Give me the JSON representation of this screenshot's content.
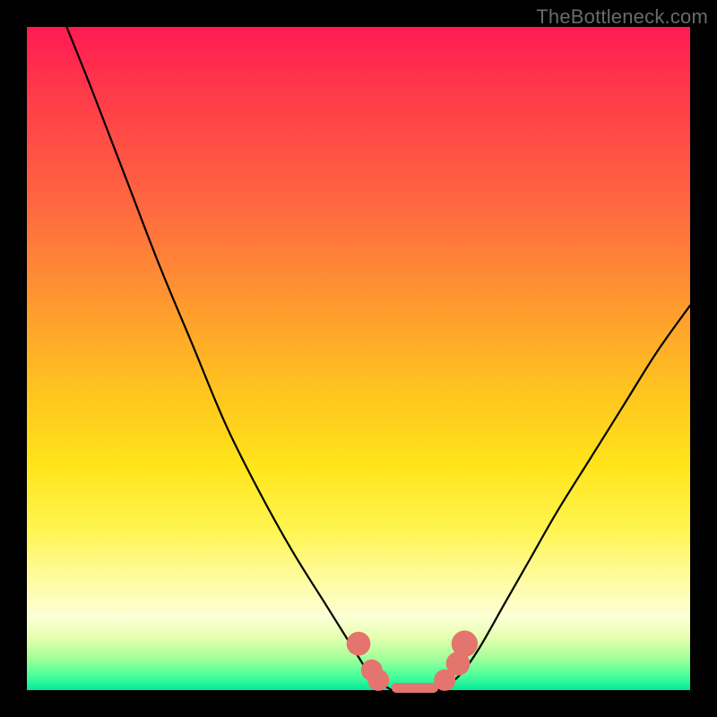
{
  "watermark": "TheBottleneck.com",
  "colors": {
    "background": "#000000",
    "curve": "#000000",
    "marker": "#e4746e",
    "gradient_top": "#ff1a52",
    "gradient_bottom": "#00e89a"
  },
  "chart_data": {
    "type": "line",
    "title": "",
    "xlabel": "",
    "ylabel": "",
    "xlim": [
      0,
      100
    ],
    "ylim": [
      0,
      100
    ],
    "note": "Two curves descending into a common valley near x≈52–62 at y≈0, with the right branch rising less steeply than the left. Values are read approximately from the image; axes have no tick labels so x and y are normalized 0–100.",
    "series": [
      {
        "name": "left-branch",
        "x": [
          6,
          10,
          15,
          20,
          25,
          30,
          35,
          40,
          45,
          50,
          52,
          55
        ],
        "y": [
          100,
          90,
          77,
          64,
          52,
          40,
          30,
          21,
          13,
          5,
          2,
          0
        ]
      },
      {
        "name": "right-branch",
        "x": [
          62,
          65,
          68,
          72,
          76,
          80,
          85,
          90,
          95,
          100
        ],
        "y": [
          0,
          2,
          6,
          13,
          20,
          27,
          35,
          43,
          51,
          58
        ]
      }
    ],
    "floor_segment": {
      "x_start": 55,
      "x_end": 62,
      "y": 0
    },
    "markers": [
      {
        "x": 50,
        "y": 7,
        "r": 1.4
      },
      {
        "x": 52,
        "y": 3,
        "r": 1.2
      },
      {
        "x": 53,
        "y": 1.5,
        "r": 1.2
      },
      {
        "x": 63,
        "y": 1.5,
        "r": 1.2
      },
      {
        "x": 65,
        "y": 4,
        "r": 1.4
      },
      {
        "x": 66,
        "y": 7,
        "r": 1.6
      }
    ]
  }
}
